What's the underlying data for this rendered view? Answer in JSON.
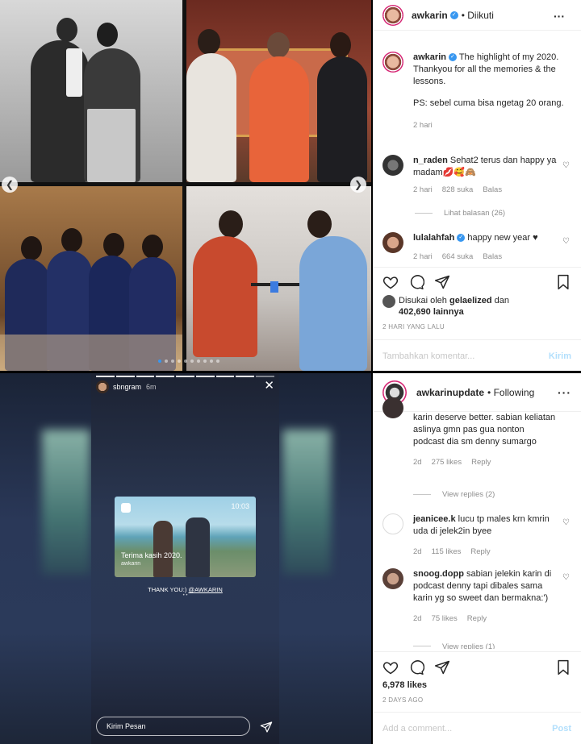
{
  "post1": {
    "header": {
      "username": "awkarin",
      "follow_state": "• Diikuti"
    },
    "caption": {
      "username": "awkarin",
      "text": "The highlight of my 2020. Thankyou for all the memories & the lessons.",
      "ps": "PS: sebel cuma bisa ngetag 20 orang.",
      "time": "2 hari"
    },
    "comments": [
      {
        "username": "n_raden",
        "text": "Sehat2 terus dan happy ya madam💋🥰🙈",
        "time": "2 hari",
        "likes": "828 suka",
        "reply": "Balas"
      },
      {
        "username": "lulalahfah",
        "text": "happy new year ♥",
        "time": "2 hari",
        "likes": "664 suka",
        "reply": "Balas"
      }
    ],
    "view_replies": "Lihat balasan (26)",
    "liked_by_prefix": "Disukai oleh",
    "liked_by_user": "gelaelized",
    "liked_by_and": "dan",
    "liked_by_count": "402,690 lainnya",
    "ago": "2 HARI YANG LALU",
    "add_comment_placeholder": "Tambahkan komentar...",
    "send_label": "Kirim"
  },
  "story": {
    "username": "sbngram",
    "time": "6m",
    "media_time": "10:03",
    "caption1": "Terima kasih 2020.",
    "caption2": "awkarin",
    "thanks_prefix": "THANK YOU:) ",
    "thanks_mention": "@AWKARIN",
    "thanks_sub": "• •",
    "input_placeholder": "Kirim Pesan",
    "progress_done": 8,
    "progress_total": 9
  },
  "post2": {
    "header": {
      "username": "awkarinupdate",
      "follow_state": "• Following"
    },
    "comments": [
      {
        "username": "",
        "text": "karin deserve better. sabian keliatan aslinya gmn pas gua nonton podcast dia sm denny sumargo",
        "time": "2d",
        "likes": "275 likes",
        "reply": "Reply"
      },
      {
        "username": "jeanicee.k",
        "text": "lucu tp males krn kmrin uda di jelek2in byee",
        "time": "2d",
        "likes": "115 likes",
        "reply": "Reply"
      },
      {
        "username": "snoog.dopp",
        "text": "sabian jelekin karin di podcast denny tapi dibales sama karin yg so sweet dan bermakna:')",
        "time": "2d",
        "likes": "75 likes",
        "reply": "Reply"
      }
    ],
    "view_replies": "View replies (2)",
    "view_replies_cut": "View replies (1)",
    "likes": "6,978 likes",
    "ago": "2 DAYS AGO",
    "add_comment_placeholder": "Add a comment...",
    "send_label": "Post"
  },
  "colors": {
    "link_blue": "#3897f0",
    "send_disabled": "#b2dffc",
    "meta_gray": "#8e8e8e",
    "heart_red": "#ed4956"
  }
}
